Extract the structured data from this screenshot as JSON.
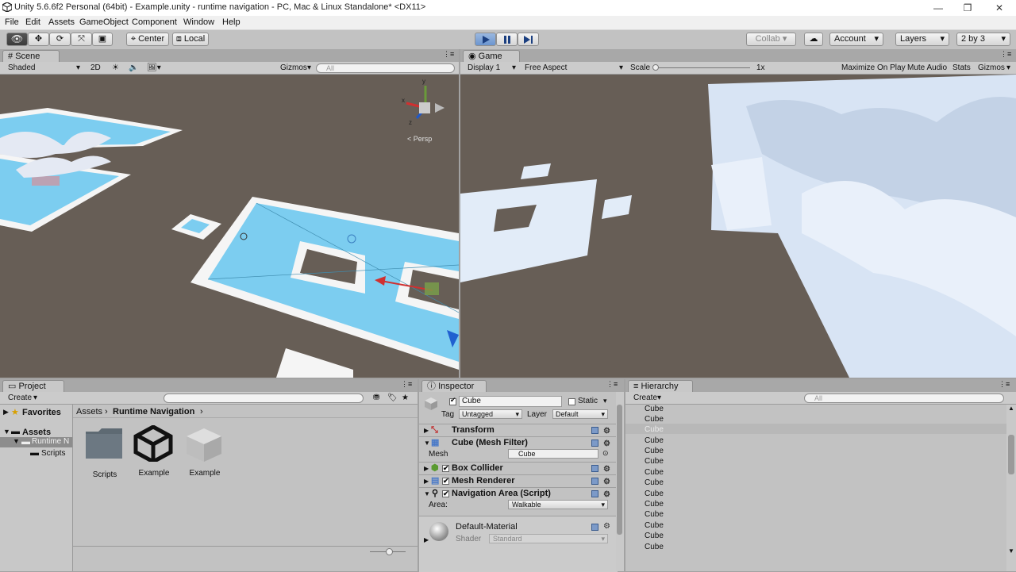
{
  "window": {
    "title": "Unity 5.6.6f2 Personal (64bit) - Example.unity - runtime navigation - PC, Mac & Linux Standalone* <DX11>",
    "minimize": "—",
    "restore": "❐",
    "close": "✕"
  },
  "menu": [
    "File",
    "Edit",
    "Assets",
    "GameObject",
    "Component",
    "Window",
    "Help"
  ],
  "toolbar": {
    "pivot_center": "Center",
    "pivot_local": "Local",
    "collab": "Collab ▾",
    "account": "Account",
    "layers": "Layers",
    "layout": "2 by 3"
  },
  "scene": {
    "tab": "Scene",
    "shading": "Shaded",
    "mode_2d": "2D",
    "gizmos": "Gizmos",
    "search_placeholder": "All",
    "persp": "< Persp"
  },
  "game": {
    "tab": "Game",
    "display": "Display 1",
    "aspect": "Free Aspect",
    "scale_label": "Scale",
    "scale_value": "1x",
    "maximize": "Maximize On Play",
    "mute": "Mute Audio",
    "stats": "Stats",
    "gizmos": "Gizmos"
  },
  "project": {
    "tab": "Project",
    "create": "Create",
    "favorites": "Favorites",
    "breadcrumb_root": "Assets",
    "breadcrumb_current": "Runtime Navigation",
    "tree": {
      "assets": "Assets",
      "runtime": "Runtime N",
      "scripts": "Scripts"
    },
    "items": [
      {
        "label": "Scripts",
        "icon": "folder-icon"
      },
      {
        "label": "Example",
        "icon": "unity-scene-icon"
      },
      {
        "label": "Example",
        "icon": "prefab-icon"
      }
    ]
  },
  "inspector": {
    "tab": "Inspector",
    "object_name": "Cube",
    "static_label": "Static",
    "tag_label": "Tag",
    "tag_value": "Untagged",
    "layer_label": "Layer",
    "layer_value": "Default",
    "components": {
      "transform": "Transform",
      "mesh_filter": "Cube (Mesh Filter)",
      "mesh_label": "Mesh",
      "mesh_value": "Cube",
      "box_collider": "Box Collider",
      "mesh_renderer": "Mesh Renderer",
      "nav_area": "Navigation Area (Script)",
      "area_label": "Area:",
      "area_value": "Walkable"
    },
    "material": {
      "name": "Default-Material",
      "shader_label": "Shader",
      "shader_value": "Standard"
    }
  },
  "hierarchy": {
    "tab": "Hierarchy",
    "create": "Create",
    "search_placeholder": "All",
    "items": [
      "Cube",
      "Cube",
      "Cube",
      "Cube",
      "Cube",
      "Cube",
      "Cube",
      "Cube",
      "Cube",
      "Cube",
      "Cube",
      "Cube",
      "Cube",
      "Cube"
    ],
    "selected_index": 2
  },
  "colors": {
    "play_active": "#5a86cc",
    "navmesh_blue": "#7ccdf0",
    "ground": "#675e56",
    "terrain": "#d8e4f4",
    "selection": "#b8b8b8"
  }
}
